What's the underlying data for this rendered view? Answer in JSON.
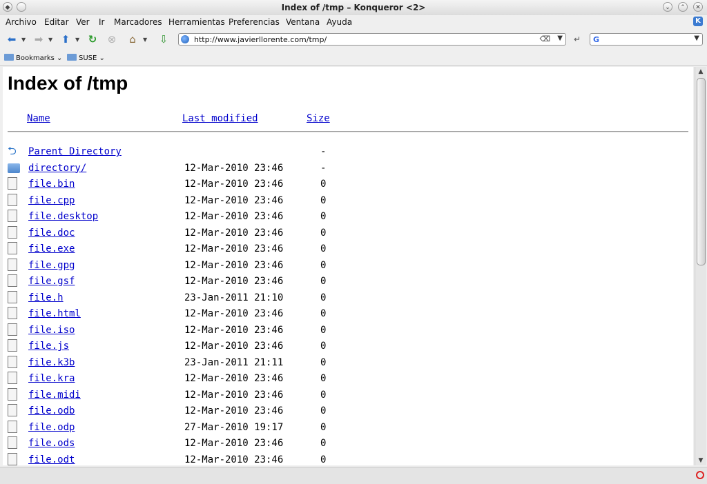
{
  "window": {
    "title": "Index of /tmp – Konqueror <2>"
  },
  "menu": [
    "Archivo",
    "Editar",
    "Ver",
    "Ir",
    "Marcadores",
    "Herramientas",
    "Preferencias",
    "Ventana",
    "Ayuda"
  ],
  "location": {
    "url": "http://www.javierllorente.com/tmp/"
  },
  "bookmarks": [
    "Bookmarks",
    "SUSE"
  ],
  "page": {
    "heading": "Index of /tmp",
    "columns": {
      "name": "Name",
      "modified": "Last modified",
      "size": "Size"
    },
    "rows": [
      {
        "name": "Parent Directory",
        "date": "",
        "size": "-",
        "icon": "back-icon"
      },
      {
        "name": "directory/",
        "date": "12-Mar-2010 23:46",
        "size": "-",
        "icon": "folder-icon"
      },
      {
        "name": "file.bin",
        "date": "12-Mar-2010 23:46",
        "size": "0",
        "icon": "binary-file-icon"
      },
      {
        "name": "file.cpp",
        "date": "12-Mar-2010 23:46",
        "size": "0",
        "icon": "cpp-file-icon"
      },
      {
        "name": "file.desktop",
        "date": "12-Mar-2010 23:46",
        "size": "0",
        "icon": "desktop-file-icon"
      },
      {
        "name": "file.doc",
        "date": "12-Mar-2010 23:46",
        "size": "0",
        "icon": "doc-file-icon"
      },
      {
        "name": "file.exe",
        "date": "12-Mar-2010 23:46",
        "size": "0",
        "icon": "exe-file-icon"
      },
      {
        "name": "file.gpg",
        "date": "12-Mar-2010 23:46",
        "size": "0",
        "icon": "gpg-file-icon"
      },
      {
        "name": "file.gsf",
        "date": "12-Mar-2010 23:46",
        "size": "0",
        "icon": "font-file-icon"
      },
      {
        "name": "file.h",
        "date": "23-Jan-2011 21:10",
        "size": "0",
        "icon": "header-file-icon"
      },
      {
        "name": "file.html",
        "date": "12-Mar-2010 23:46",
        "size": "0",
        "icon": "html-file-icon"
      },
      {
        "name": "file.iso",
        "date": "12-Mar-2010 23:46",
        "size": "0",
        "icon": "iso-file-icon"
      },
      {
        "name": "file.js",
        "date": "12-Mar-2010 23:46",
        "size": "0",
        "icon": "js-file-icon"
      },
      {
        "name": "file.k3b",
        "date": "23-Jan-2011 21:11",
        "size": "0",
        "icon": "k3b-file-icon"
      },
      {
        "name": "file.kra",
        "date": "12-Mar-2010 23:46",
        "size": "0",
        "icon": "kra-file-icon"
      },
      {
        "name": "file.midi",
        "date": "12-Mar-2010 23:46",
        "size": "0",
        "icon": "midi-file-icon"
      },
      {
        "name": "file.odb",
        "date": "12-Mar-2010 23:46",
        "size": "0",
        "icon": "odb-file-icon"
      },
      {
        "name": "file.odp",
        "date": "27-Mar-2010 19:17",
        "size": "0",
        "icon": "odp-file-icon"
      },
      {
        "name": "file.ods",
        "date": "12-Mar-2010 23:46",
        "size": "0",
        "icon": "ods-file-icon"
      },
      {
        "name": "file.odt",
        "date": "12-Mar-2010 23:46",
        "size": "0",
        "icon": "odt-file-icon"
      }
    ]
  },
  "colors": {
    "link": "#0000cc",
    "chrome": "#efefef"
  }
}
